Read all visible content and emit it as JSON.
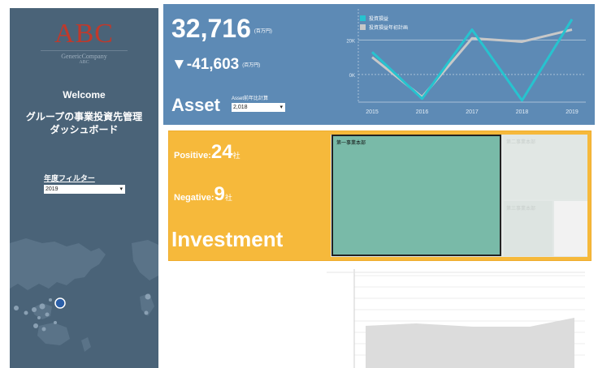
{
  "sidebar": {
    "logo": "ABC",
    "logo_sub": "GenericCompany",
    "logo_sub2": "ABC",
    "welcome": "Welcome",
    "title_line1": "グループの事業投資先管理",
    "title_line2": "ダッシュボード",
    "year_filter_label": "年度フィルター",
    "year_filter_value": "2019"
  },
  "asset": {
    "value": "32,716",
    "value_unit": "(百万円)",
    "delta": "▼-41,603",
    "delta_unit": "(百万円)",
    "label": "Asset",
    "filter_label": "Asset前年比計算",
    "filter_value": "2,018"
  },
  "chart_data": {
    "type": "line",
    "x": [
      "2015",
      "2016",
      "2017",
      "2018",
      "2019"
    ],
    "ytick_labels": [
      "20K",
      "0K"
    ],
    "ylim": [
      -16000,
      38000
    ],
    "series": [
      {
        "name": "投資損益",
        "values": [
          13000,
          -14000,
          26000,
          -15000,
          32000
        ],
        "color": "#27c3cf"
      },
      {
        "name": "投資損益年初計画",
        "values": [
          10000,
          -13000,
          21000,
          19000,
          26000
        ],
        "color": "#c8c8c8"
      }
    ],
    "grid": true,
    "legend": "top-left"
  },
  "investment": {
    "positive_label": "Positive:",
    "positive_value": "24",
    "positive_suffix": "社",
    "negative_label": "Negative:",
    "negative_value": "9",
    "negative_suffix": "社",
    "label": "Investment",
    "treemap": {
      "cell1": "第一事業本部",
      "cell2": "第二事業本部",
      "cell3": "第三事業本部"
    }
  }
}
